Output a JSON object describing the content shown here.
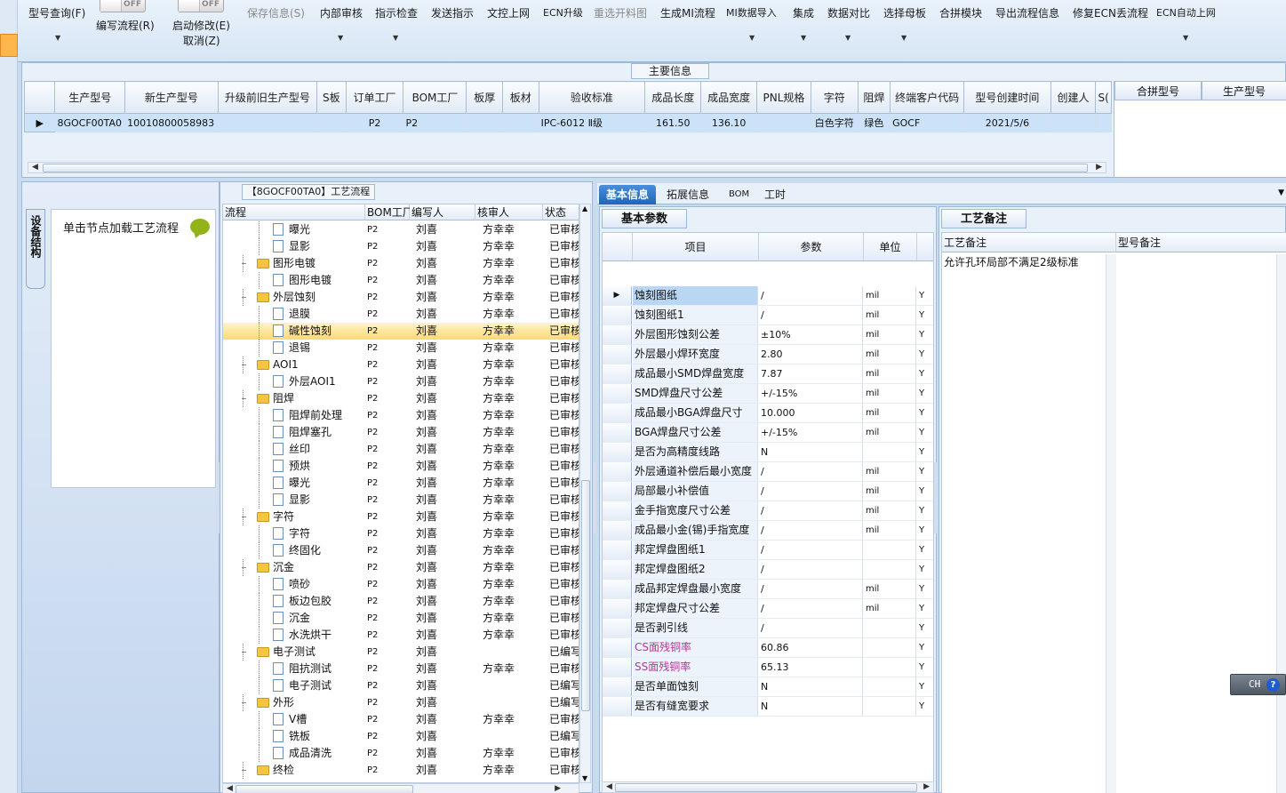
{
  "toolbar": {
    "items": [
      {
        "label": "型号查询(F)",
        "disabled": false
      },
      {
        "label": "编写流程(R)",
        "disabled": false
      },
      {
        "label": "启动修改(E)",
        "disabled": false
      },
      {
        "label": "取消(Z)",
        "disabled": false
      },
      {
        "label": "保存信息(S)",
        "disabled": true
      },
      {
        "label": "内部审核",
        "disabled": false
      },
      {
        "label": "指示检查",
        "disabled": false
      },
      {
        "label": "发送指示",
        "disabled": false
      },
      {
        "label": "文控上网",
        "disabled": false
      },
      {
        "label": "ECN升级",
        "disabled": false
      },
      {
        "label": "重选开料图",
        "disabled": true
      },
      {
        "label": "生成MI流程",
        "disabled": false
      },
      {
        "label": "MI数据导入",
        "disabled": false
      },
      {
        "label": "集成",
        "disabled": false
      },
      {
        "label": "数据对比",
        "disabled": false
      },
      {
        "label": "选择母板",
        "disabled": false
      },
      {
        "label": "合拼模块",
        "disabled": false
      },
      {
        "label": "导出流程信息",
        "disabled": false
      },
      {
        "label": "修复ECN丢流程",
        "disabled": false
      },
      {
        "label": "ECN自动上网",
        "disabled": false
      }
    ],
    "toggle_off": "OFF"
  },
  "main_info": {
    "title": "主要信息",
    "columns": [
      "生产型号",
      "新生产型号",
      "升级前旧生产型号",
      "S板",
      "订单工厂",
      "BOM工厂",
      "板厚",
      "板材",
      "验收标准",
      "成品长度",
      "成品宽度",
      "PNL规格",
      "字符",
      "阻焊",
      "终端客户代码",
      "型号创建时间",
      "创建人",
      "S("
    ],
    "row": [
      "8GOCF00TA0",
      "10010800058983",
      "",
      "",
      "P2",
      "P2",
      "",
      "",
      "IPC-6012 Ⅱ级",
      "161.50",
      "136.10",
      "",
      "白色字符",
      "绿色",
      "GOCF",
      "2021/5/6",
      "",
      ""
    ],
    "side_columns": [
      "合拼型号",
      "生产型号"
    ]
  },
  "left_panel": {
    "side_tab": "设备结构",
    "hint": "单击节点加载工艺流程"
  },
  "flow": {
    "title": "【8GOCF00TA0】工艺流程",
    "columns": [
      "流程",
      "BOM工厂",
      "编写人",
      "核审人",
      "状态"
    ],
    "rows": [
      {
        "name": "曝光",
        "type": "doc",
        "level": 2,
        "bom": "P2",
        "writer": "刘喜",
        "reviewer": "方幸幸",
        "status": "已审核"
      },
      {
        "name": "显影",
        "type": "doc",
        "level": 2,
        "bom": "P2",
        "writer": "刘喜",
        "reviewer": "方幸幸",
        "status": "已审核"
      },
      {
        "name": "图形电镀",
        "type": "folder",
        "level": 1,
        "bom": "P2",
        "writer": "刘喜",
        "reviewer": "方幸幸",
        "status": "已审核"
      },
      {
        "name": "图形电镀",
        "type": "doc",
        "level": 2,
        "bom": "P2",
        "writer": "刘喜",
        "reviewer": "方幸幸",
        "status": "已审核"
      },
      {
        "name": "外层蚀刻",
        "type": "folder",
        "level": 1,
        "bom": "P2",
        "writer": "刘喜",
        "reviewer": "方幸幸",
        "status": "已审核"
      },
      {
        "name": "退膜",
        "type": "doc",
        "level": 2,
        "bom": "P2",
        "writer": "刘喜",
        "reviewer": "方幸幸",
        "status": "已审核"
      },
      {
        "name": "碱性蚀刻",
        "type": "doc",
        "level": 2,
        "bom": "P2",
        "writer": "刘喜",
        "reviewer": "方幸幸",
        "status": "已审核",
        "selected": true
      },
      {
        "name": "退锡",
        "type": "doc",
        "level": 2,
        "bom": "P2",
        "writer": "刘喜",
        "reviewer": "方幸幸",
        "status": "已审核"
      },
      {
        "name": "AOI1",
        "type": "folder",
        "level": 1,
        "bom": "P2",
        "writer": "刘喜",
        "reviewer": "方幸幸",
        "status": "已审核"
      },
      {
        "name": "外层AOI1",
        "type": "doc",
        "level": 2,
        "bom": "P2",
        "writer": "刘喜",
        "reviewer": "方幸幸",
        "status": "已审核"
      },
      {
        "name": "阻焊",
        "type": "folder",
        "level": 1,
        "bom": "P2",
        "writer": "刘喜",
        "reviewer": "方幸幸",
        "status": "已审核"
      },
      {
        "name": "阻焊前处理",
        "type": "doc",
        "level": 2,
        "bom": "P2",
        "writer": "刘喜",
        "reviewer": "方幸幸",
        "status": "已审核"
      },
      {
        "name": "阻焊塞孔",
        "type": "doc",
        "level": 2,
        "bom": "P2",
        "writer": "刘喜",
        "reviewer": "方幸幸",
        "status": "已审核"
      },
      {
        "name": "丝印",
        "type": "doc",
        "level": 2,
        "bom": "P2",
        "writer": "刘喜",
        "reviewer": "方幸幸",
        "status": "已审核"
      },
      {
        "name": "预烘",
        "type": "doc",
        "level": 2,
        "bom": "P2",
        "writer": "刘喜",
        "reviewer": "方幸幸",
        "status": "已审核"
      },
      {
        "name": "曝光",
        "type": "doc",
        "level": 2,
        "bom": "P2",
        "writer": "刘喜",
        "reviewer": "方幸幸",
        "status": "已审核"
      },
      {
        "name": "显影",
        "type": "doc",
        "level": 2,
        "bom": "P2",
        "writer": "刘喜",
        "reviewer": "方幸幸",
        "status": "已审核"
      },
      {
        "name": "字符",
        "type": "folder",
        "level": 1,
        "bom": "P2",
        "writer": "刘喜",
        "reviewer": "方幸幸",
        "status": "已审核"
      },
      {
        "name": "字符",
        "type": "doc",
        "level": 2,
        "bom": "P2",
        "writer": "刘喜",
        "reviewer": "方幸幸",
        "status": "已审核"
      },
      {
        "name": "终固化",
        "type": "doc",
        "level": 2,
        "bom": "P2",
        "writer": "刘喜",
        "reviewer": "方幸幸",
        "status": "已审核"
      },
      {
        "name": "沉金",
        "type": "folder",
        "level": 1,
        "bom": "P2",
        "writer": "刘喜",
        "reviewer": "方幸幸",
        "status": "已审核"
      },
      {
        "name": "喷砂",
        "type": "doc",
        "level": 2,
        "bom": "P2",
        "writer": "刘喜",
        "reviewer": "方幸幸",
        "status": "已审核"
      },
      {
        "name": "板边包胶",
        "type": "doc",
        "level": 2,
        "bom": "P2",
        "writer": "刘喜",
        "reviewer": "方幸幸",
        "status": "已审核"
      },
      {
        "name": "沉金",
        "type": "doc",
        "level": 2,
        "bom": "P2",
        "writer": "刘喜",
        "reviewer": "方幸幸",
        "status": "已审核"
      },
      {
        "name": "水洗烘干",
        "type": "doc",
        "level": 2,
        "bom": "P2",
        "writer": "刘喜",
        "reviewer": "方幸幸",
        "status": "已审核"
      },
      {
        "name": "电子测试",
        "type": "folder",
        "level": 1,
        "bom": "P2",
        "writer": "刘喜",
        "reviewer": "",
        "status": "已编写"
      },
      {
        "name": "阻抗测试",
        "type": "doc",
        "level": 2,
        "bom": "P2",
        "writer": "刘喜",
        "reviewer": "方幸幸",
        "status": "已审核"
      },
      {
        "name": "电子测试",
        "type": "doc",
        "level": 2,
        "bom": "P2",
        "writer": "刘喜",
        "reviewer": "",
        "status": "已编写"
      },
      {
        "name": "外形",
        "type": "folder",
        "level": 1,
        "bom": "P2",
        "writer": "刘喜",
        "reviewer": "",
        "status": "已编写"
      },
      {
        "name": "V槽",
        "type": "doc",
        "level": 2,
        "bom": "P2",
        "writer": "刘喜",
        "reviewer": "方幸幸",
        "status": "已审核"
      },
      {
        "name": "铣板",
        "type": "doc",
        "level": 2,
        "bom": "P2",
        "writer": "刘喜",
        "reviewer": "",
        "status": "已编写"
      },
      {
        "name": "成品清洗",
        "type": "doc",
        "level": 2,
        "bom": "P2",
        "writer": "刘喜",
        "reviewer": "方幸幸",
        "status": "已审核"
      },
      {
        "name": "终检",
        "type": "folder",
        "level": 1,
        "bom": "P2",
        "writer": "刘喜",
        "reviewer": "方幸幸",
        "status": "已审核"
      }
    ]
  },
  "right_tabs": [
    "基本信息",
    "拓展信息",
    "BOM",
    "工时"
  ],
  "params": {
    "section_title": "基本参数",
    "columns": [
      "项目",
      "参数",
      "单位"
    ],
    "rows": [
      {
        "item": "蚀刻图纸",
        "value": "/",
        "unit": "mil",
        "flag": "Y"
      },
      {
        "item": "蚀刻图纸1",
        "value": "/",
        "unit": "mil",
        "flag": "Y"
      },
      {
        "item": "外层图形蚀刻公差",
        "value": "±10%",
        "unit": "mil",
        "flag": "Y"
      },
      {
        "item": "外层最小焊环宽度",
        "value": "2.80",
        "unit": "mil",
        "flag": "Y"
      },
      {
        "item": "成品最小SMD焊盘宽度",
        "value": "7.87",
        "unit": "mil",
        "flag": "Y"
      },
      {
        "item": "SMD焊盘尺寸公差",
        "value": "+/-15%",
        "unit": "mil",
        "flag": "Y"
      },
      {
        "item": "成品最小BGA焊盘尺寸",
        "value": "10.000",
        "unit": "mil",
        "flag": "Y"
      },
      {
        "item": "BGA焊盘尺寸公差",
        "value": "+/-15%",
        "unit": "mil",
        "flag": "Y"
      },
      {
        "item": "是否为高精度线路",
        "value": "N",
        "unit": "",
        "flag": "Y"
      },
      {
        "item": "外层通道补偿后最小宽度",
        "value": "/",
        "unit": "mil",
        "flag": "Y"
      },
      {
        "item": "局部最小补偿值",
        "value": "/",
        "unit": "mil",
        "flag": "Y"
      },
      {
        "item": "金手指宽度尺寸公差",
        "value": "/",
        "unit": "mil",
        "flag": "Y"
      },
      {
        "item": "成品最小金(锡)手指宽度",
        "value": "/",
        "unit": "mil",
        "flag": "Y"
      },
      {
        "item": "邦定焊盘图纸1",
        "value": "/",
        "unit": "",
        "flag": "Y"
      },
      {
        "item": "邦定焊盘图纸2",
        "value": "/",
        "unit": "",
        "flag": "Y"
      },
      {
        "item": "成品邦定焊盘最小宽度",
        "value": "/",
        "unit": "mil",
        "flag": "Y"
      },
      {
        "item": "邦定焊盘尺寸公差",
        "value": "/",
        "unit": "mil",
        "flag": "Y"
      },
      {
        "item": "是否剥引线",
        "value": "/",
        "unit": "",
        "flag": "Y"
      },
      {
        "item": "CS面残铜率",
        "value": "60.86",
        "unit": "",
        "flag": "Y",
        "highlight": true
      },
      {
        "item": "SS面残铜率",
        "value": "65.13",
        "unit": "",
        "flag": "Y",
        "highlight": true
      },
      {
        "item": "是否单面蚀刻",
        "value": "N",
        "unit": "",
        "flag": "Y"
      },
      {
        "item": "是否有缝宽要求",
        "value": "N",
        "unit": "",
        "flag": "Y"
      }
    ]
  },
  "notes": {
    "section_title": "工艺备注",
    "columns": [
      "工艺备注",
      "型号备注"
    ],
    "process_note": "允许孔环局部不满足2级标准"
  },
  "ime": {
    "label": "CH",
    "help": "?"
  },
  "colors": {
    "accent": "#1f65b8",
    "selected_row": "#ffd975",
    "highlight_text": "#c0309a"
  }
}
